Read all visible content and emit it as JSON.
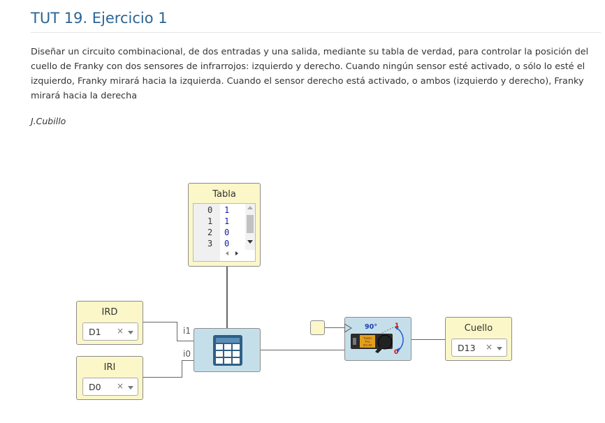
{
  "page": {
    "title": "TUT 19. Ejercicio 1",
    "description": "Diseñar un circuito combinacional, de dos entradas y una salida, mediante su tabla de verdad, para controlar la posición del cuello de Franky con dos sensores de infrarrojos: izquierdo y derecho. Cuando ningún sensor esté activado, o sólo lo esté el izquierdo, Franky mirará hacia la izquierda. Cuando el sensor derecho está activado, o ambos (izquierdo y derecho), Franky mirará hacia la derecha",
    "author": "J.Cubillo"
  },
  "blocks": {
    "tabla": {
      "title": "Tabla",
      "rows": [
        {
          "index": "0",
          "value": "1"
        },
        {
          "index": "1",
          "value": "1"
        },
        {
          "index": "2",
          "value": "0"
        },
        {
          "index": "3",
          "value": "0"
        }
      ]
    },
    "ird": {
      "title": "IRD",
      "pin": "D1",
      "clear": "×"
    },
    "iri": {
      "title": "IRI",
      "pin": "D0",
      "clear": "×"
    },
    "cuello": {
      "title": "Cuello",
      "pin": "D13",
      "clear": "×"
    },
    "table_block": {
      "input_i1": "i1",
      "input_i0": "i0",
      "icon": "table-icon"
    },
    "servo": {
      "angle_label": "90°",
      "label_1": "1",
      "label_0": "0",
      "brand": "Tower Pro SG-90",
      "icon": "servo-icon"
    }
  },
  "colors": {
    "title": "#2a6496",
    "yellow_block": "#fbf7c8",
    "blue_block": "#c5dfea",
    "table_icon": "#2f5f86",
    "servo_body": "#2b2b2b",
    "arrow": "#1e5bd6",
    "value_red": "#e00000"
  }
}
